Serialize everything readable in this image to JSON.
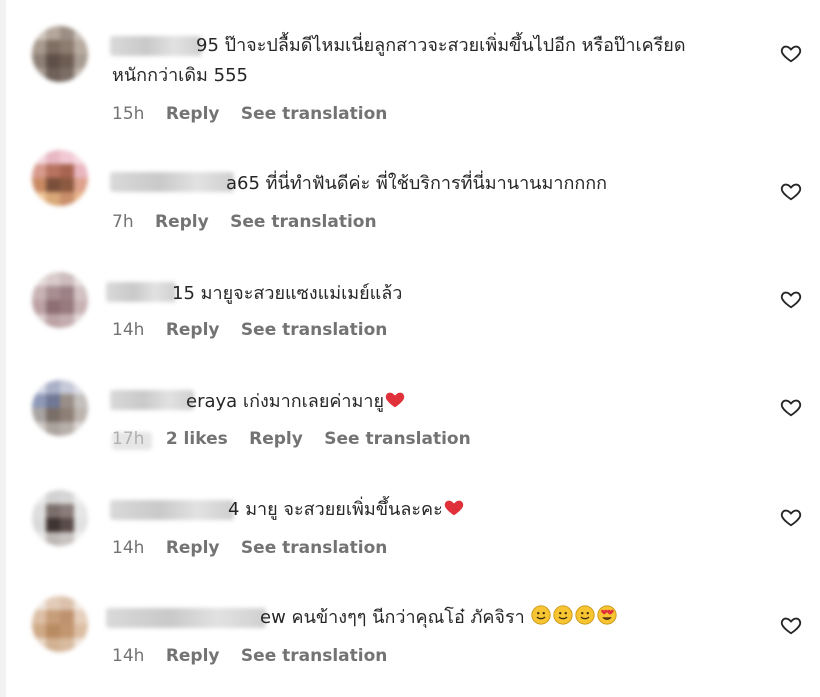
{
  "comments": [
    {
      "handle_tail": "95",
      "text_line1": "ป๊าจะปลื้มดีไหมเนี่ยลูกสาวจะสวยเพิ่มขึ้นไปอีก หรือป๊าเครียด",
      "text_line2": "หนักกว่าเดิม 555",
      "time": "15h",
      "reply": "Reply",
      "translate": "See translation"
    },
    {
      "handle_tail": "a65",
      "text_line1": "ที่นี่ทำฟันดีค่ะ พี่ใช้บริการที่นี่มานานมากกกก",
      "time": "7h",
      "reply": "Reply",
      "translate": "See translation"
    },
    {
      "handle_tail": "15",
      "text_line1": "มายูจะสวยแซงแม่เมย์แล้ว",
      "time": "14h",
      "reply": "Reply",
      "translate": "See translation"
    },
    {
      "handle_tail": "eraya",
      "text_line1": "เก่งมากเลยค่ามายู",
      "emoji": "❤",
      "time": "17h",
      "likes": "2 likes",
      "reply": "Reply",
      "translate": "See translation"
    },
    {
      "handle_tail": "4",
      "text_line1": "มายู จะสวยยเพิ่มขึ้นละคะ",
      "emoji": "❤",
      "time": "14h",
      "reply": "Reply",
      "translate": "See translation"
    },
    {
      "handle_tail": "ew",
      "text_line1": "คนข้างๆๆ นีกว่าคุณโอ๋ ภัคจิรา",
      "emojis": [
        "🙂",
        "🙂",
        "🙂",
        "😍"
      ],
      "time": "14h",
      "reply": "Reply",
      "translate": "See translation"
    }
  ],
  "icons": {
    "like": "heart-outline-icon"
  },
  "colors": {
    "text": "#262626",
    "meta": "#737373",
    "heart_red": "#e0303a",
    "emoji_yellow": "#f7c531"
  }
}
